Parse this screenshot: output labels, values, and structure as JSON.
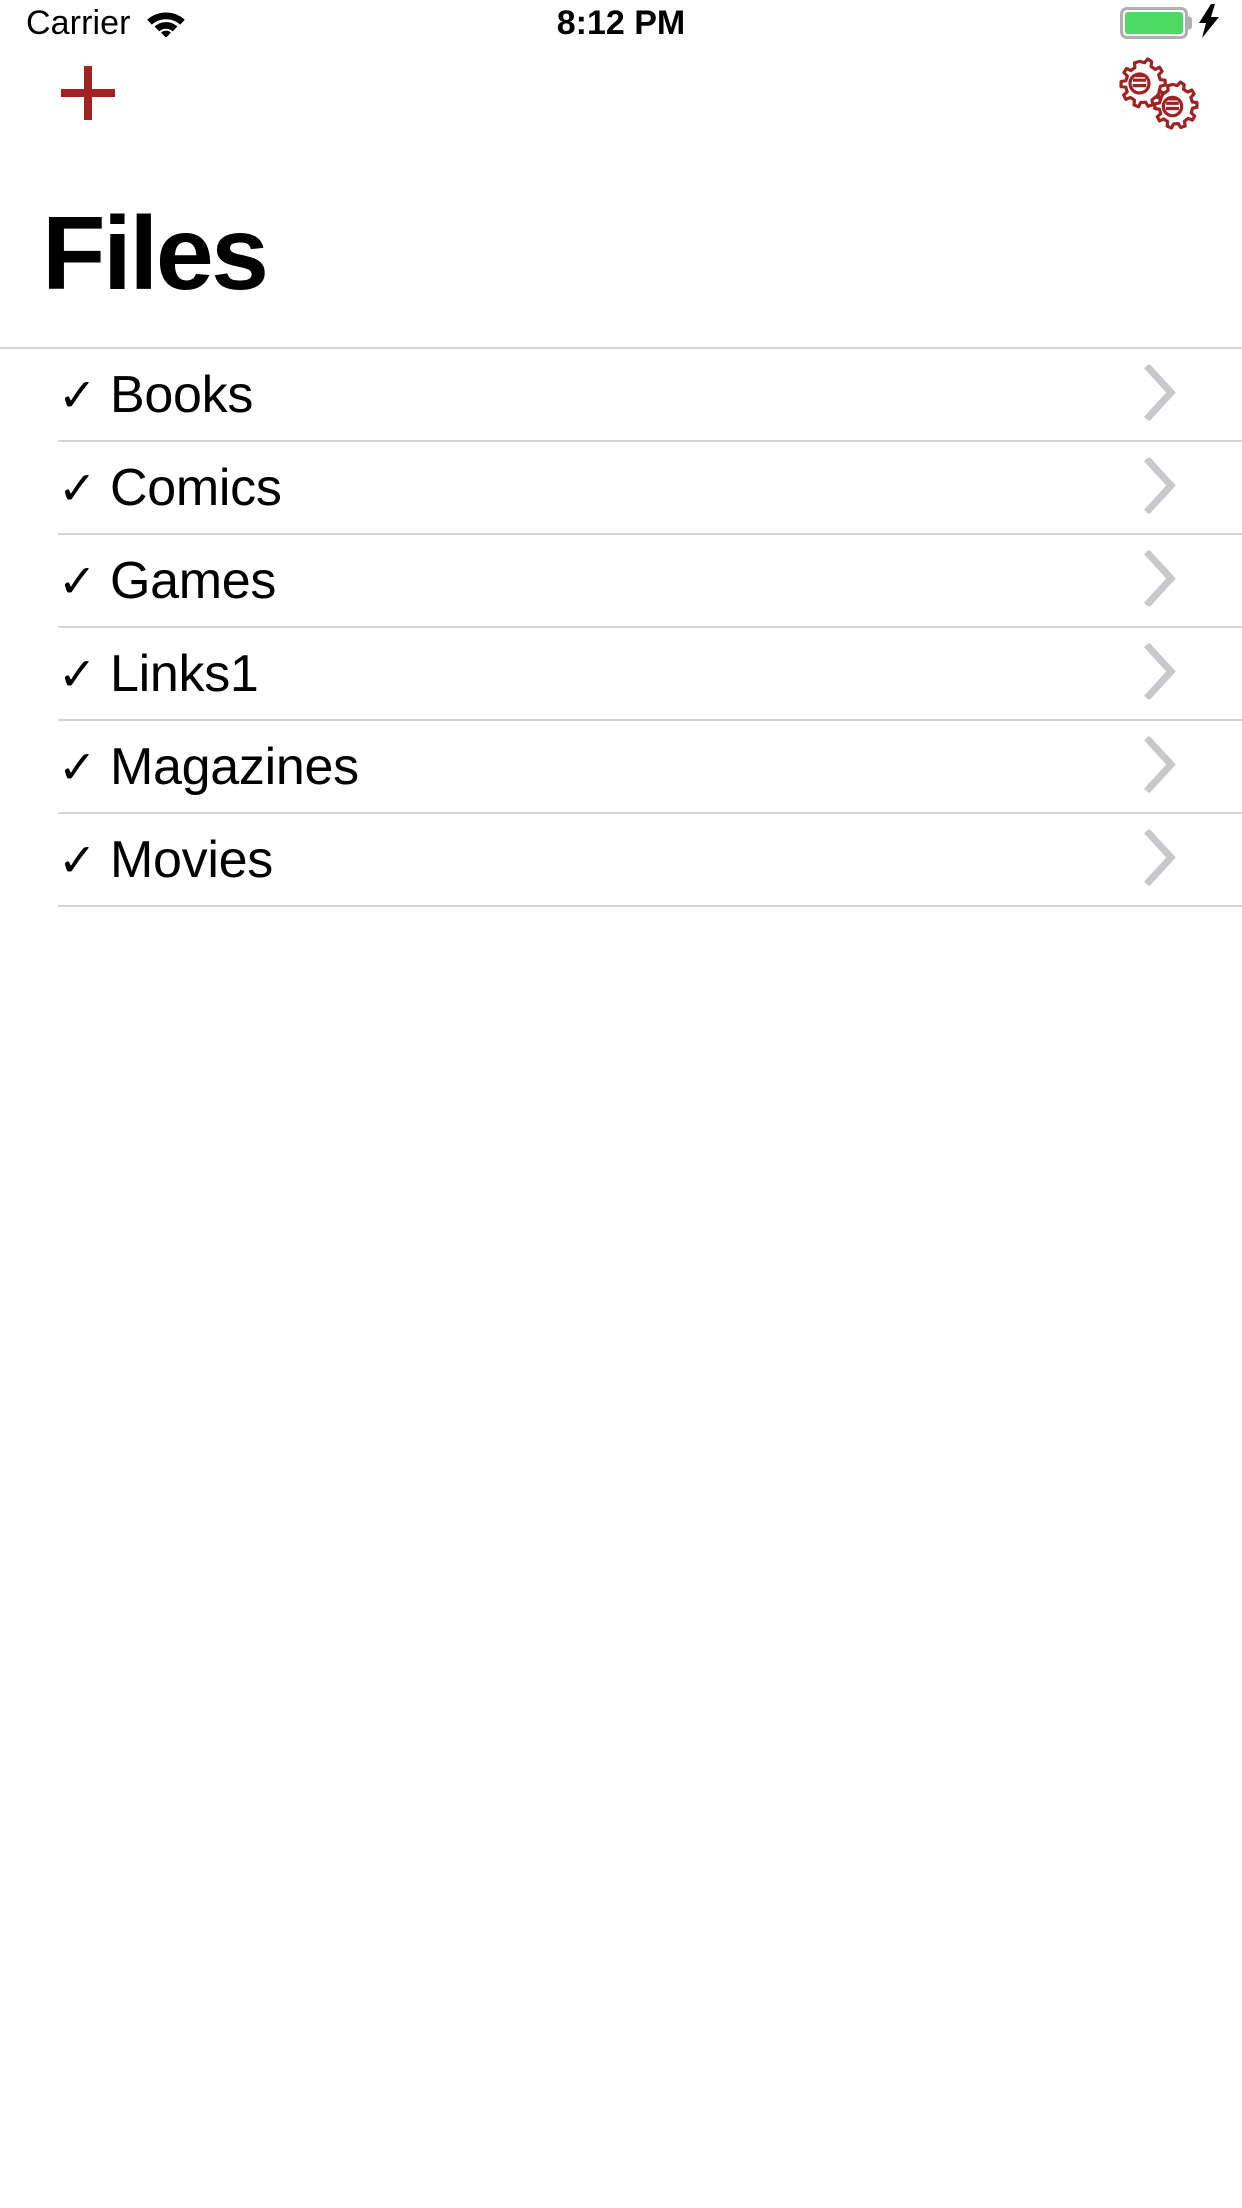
{
  "status_bar": {
    "carrier": "Carrier",
    "wifi_icon": "wifi-icon",
    "time": "8:12 PM",
    "battery_icon": "battery-full-icon",
    "battery_level_percent": 100,
    "battery_color": "#4cd964",
    "charging_icon": "lightning-bolt-icon"
  },
  "nav_bar": {
    "add_icon": "plus-icon",
    "add_label": "Add",
    "settings_icon": "gears-icon",
    "settings_label": "Settings",
    "accent_color": "#a02222"
  },
  "header": {
    "title": "Files"
  },
  "list": {
    "chevron_icon": "chevron-right-icon",
    "chevron_color": "#c7c7cc",
    "check_icon": "checkmark-icon",
    "check_glyph": "✓",
    "rows": [
      {
        "label": "Books",
        "checked": true
      },
      {
        "label": "Comics",
        "checked": true
      },
      {
        "label": "Games",
        "checked": true
      },
      {
        "label": "Links1",
        "checked": true
      },
      {
        "label": "Magazines",
        "checked": true
      },
      {
        "label": "Movies",
        "checked": true
      }
    ]
  }
}
